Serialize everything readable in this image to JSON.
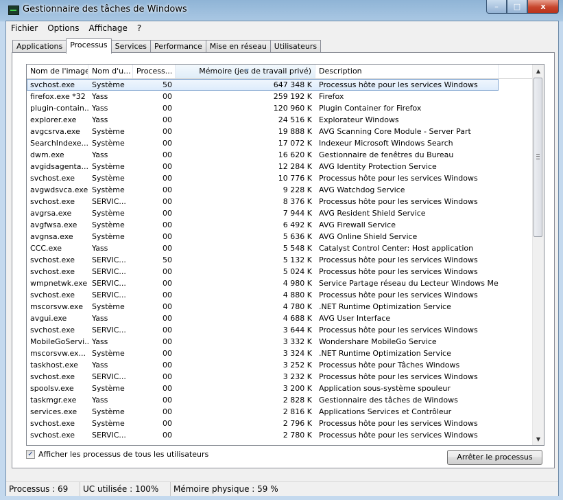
{
  "window": {
    "title": "Gestionnaire des tâches de Windows",
    "controls": {
      "minimize": "–",
      "maximize": "□",
      "close": "x"
    }
  },
  "menu": [
    "Fichier",
    "Options",
    "Affichage",
    "?"
  ],
  "tabs": [
    {
      "label": "Applications",
      "active": false
    },
    {
      "label": "Processus",
      "active": true
    },
    {
      "label": "Services",
      "active": false
    },
    {
      "label": "Performance",
      "active": false
    },
    {
      "label": "Mise en réseau",
      "active": false
    },
    {
      "label": "Utilisateurs",
      "active": false
    }
  ],
  "table": {
    "headers": [
      "Nom de l'image",
      "Nom d'u...",
      "Process...",
      "Mémoire (jeu de travail privé)",
      "Description",
      ""
    ],
    "sorted_column": "Mémoire (jeu de travail privé)",
    "rows": [
      [
        "svchost.exe",
        "Système",
        "50",
        "647 348 K",
        "Processus hôte pour les services Windows"
      ],
      [
        "firefox.exe *32",
        "Yass",
        "00",
        "259 192 K",
        "Firefox"
      ],
      [
        "plugin-contain...",
        "Yass",
        "00",
        "120 960 K",
        "Plugin Container for Firefox"
      ],
      [
        "explorer.exe",
        "Yass",
        "00",
        "24 516 K",
        "Explorateur Windows"
      ],
      [
        "avgcsrva.exe",
        "Système",
        "00",
        "19 888 K",
        "AVG Scanning Core Module - Server Part"
      ],
      [
        "SearchIndexe...",
        "Système",
        "00",
        "17 072 K",
        "Indexeur Microsoft Windows Search"
      ],
      [
        "dwm.exe",
        "Yass",
        "00",
        "16 620 K",
        "Gestionnaire de fenêtres du Bureau"
      ],
      [
        "avgidsagenta...",
        "Système",
        "00",
        "12 284 K",
        "AVG Identity Protection Service"
      ],
      [
        "svchost.exe",
        "Système",
        "00",
        "10 776 K",
        "Processus hôte pour les services Windows"
      ],
      [
        "avgwdsvca.exe",
        "Système",
        "00",
        "9 228 K",
        "AVG Watchdog Service"
      ],
      [
        "svchost.exe",
        "SERVIC...",
        "00",
        "8 376 K",
        "Processus hôte pour les services Windows"
      ],
      [
        "avgrsa.exe",
        "Système",
        "00",
        "7 944 K",
        "AVG Resident Shield Service"
      ],
      [
        "avgfwsa.exe",
        "Système",
        "00",
        "6 492 K",
        "AVG Firewall Service"
      ],
      [
        "avgnsa.exe",
        "Système",
        "00",
        "5 636 K",
        "AVG Online Shield Service"
      ],
      [
        "CCC.exe",
        "Yass",
        "00",
        "5 548 K",
        "Catalyst Control Center: Host application"
      ],
      [
        "svchost.exe",
        "SERVIC...",
        "50",
        "5 132 K",
        "Processus hôte pour les services Windows"
      ],
      [
        "svchost.exe",
        "SERVIC...",
        "00",
        "5 024 K",
        "Processus hôte pour les services Windows"
      ],
      [
        "wmpnetwk.exe",
        "SERVIC...",
        "00",
        "4 980 K",
        "Service Partage réseau du Lecteur Windows Media"
      ],
      [
        "svchost.exe",
        "SERVIC...",
        "00",
        "4 880 K",
        "Processus hôte pour les services Windows"
      ],
      [
        "mscorsvw.exe",
        "Système",
        "00",
        "4 780 K",
        ".NET Runtime Optimization Service"
      ],
      [
        "avgui.exe",
        "Yass",
        "00",
        "4 688 K",
        "AVG User Interface"
      ],
      [
        "svchost.exe",
        "SERVIC...",
        "00",
        "3 644 K",
        "Processus hôte pour les services Windows"
      ],
      [
        "MobileGoServi...",
        "Yass",
        "00",
        "3 332 K",
        "Wondershare MobileGo Service"
      ],
      [
        "mscorsvw.ex...",
        "Système",
        "00",
        "3 324 K",
        ".NET Runtime Optimization Service"
      ],
      [
        "taskhost.exe",
        "Yass",
        "00",
        "3 252 K",
        "Processus hôte pour Tâches Windows"
      ],
      [
        "svchost.exe",
        "SERVIC...",
        "00",
        "3 232 K",
        "Processus hôte pour les services Windows"
      ],
      [
        "spoolsv.exe",
        "Système",
        "00",
        "3 200 K",
        "Application sous-système spouleur"
      ],
      [
        "taskmgr.exe",
        "Yass",
        "00",
        "2 828 K",
        "Gestionnaire des tâches de Windows"
      ],
      [
        "services.exe",
        "Système",
        "00",
        "2 816 K",
        "Applications Services et Contrôleur"
      ],
      [
        "svchost.exe",
        "Système",
        "00",
        "2 796 K",
        "Processus hôte pour les services Windows"
      ],
      [
        "svchost.exe",
        "SERVIC...",
        "00",
        "2 780 K",
        "Processus hôte pour les services Windows"
      ]
    ]
  },
  "show_all_users": {
    "label": "Afficher les processus de tous les utilisateurs",
    "checked": true
  },
  "end_process_button": "Arrêter le processus",
  "status": {
    "processes": "Processus : 69",
    "cpu": "UC utilisée : 100%",
    "memory": "Mémoire physique : 59 %"
  }
}
